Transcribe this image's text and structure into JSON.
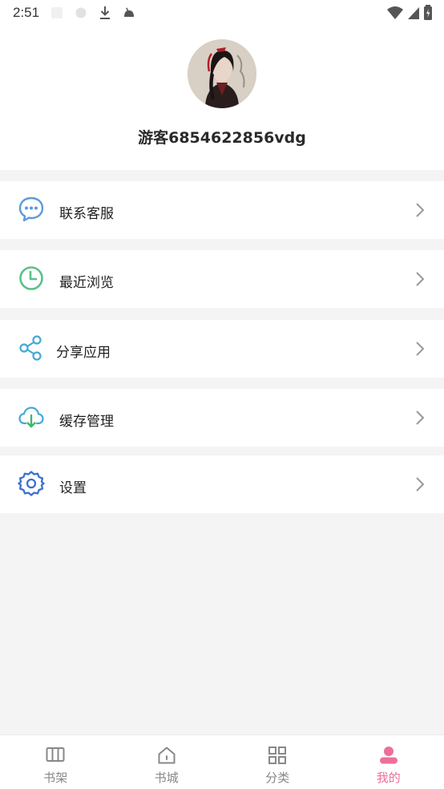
{
  "status_bar": {
    "time": "2:51"
  },
  "profile": {
    "username": "游客6854622856vdg"
  },
  "menu": [
    {
      "label": "联系客服",
      "icon": "chat-icon",
      "color": "#5b9bd8"
    },
    {
      "label": "最近浏览",
      "icon": "clock-icon",
      "color": "#5cc08a"
    },
    {
      "label": "分享应用",
      "icon": "share-icon",
      "color": "#43a9d6"
    },
    {
      "label": "缓存管理",
      "icon": "cloud-download-icon",
      "color": "#43a9d6"
    },
    {
      "label": "设置",
      "icon": "gear-icon",
      "color": "#3b6fd1"
    }
  ],
  "tabbar": {
    "items": [
      {
        "label": "书架",
        "icon": "bookshelf-icon"
      },
      {
        "label": "书城",
        "icon": "home-icon"
      },
      {
        "label": "分类",
        "icon": "grid-icon"
      },
      {
        "label": "我的",
        "icon": "user-icon",
        "active": true
      }
    ],
    "active_color": "#ee6f9a"
  }
}
